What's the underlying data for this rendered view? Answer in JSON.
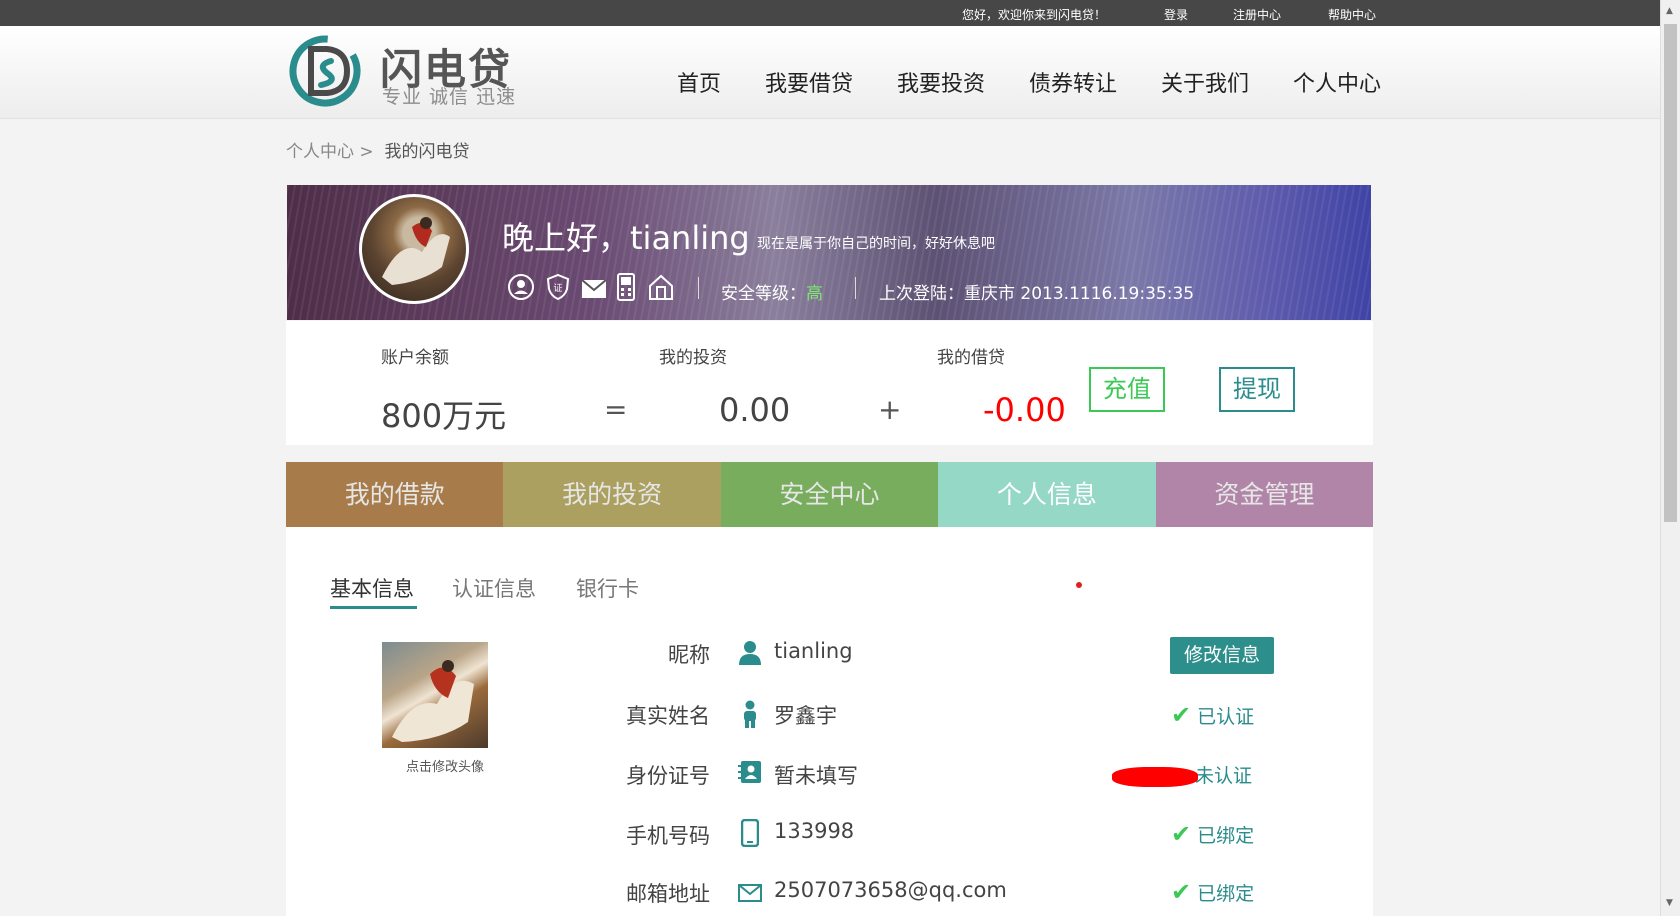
{
  "topbar": {
    "welcome": "您好，欢迎你来到闪电贷！",
    "login": "登录",
    "register": "注册中心",
    "help": "帮助中心"
  },
  "logo": {
    "title": "闪电贷",
    "slogan": "专业 诚信 迅速",
    "color": "#2a8c8c"
  },
  "nav": [
    "首页",
    "我要借贷",
    "我要投资",
    "债券转让",
    "关于我们",
    "个人中心"
  ],
  "breadcrumb": {
    "parent": "个人中心 >",
    "current": "我的闪电贷"
  },
  "banner": {
    "greeting": "晚上好，tianling",
    "subtitle": "现在是属于你自己的时间，好好休息吧",
    "security_label": "安全等级：",
    "security_level": "高",
    "last_login": "上次登陆：重庆市 2013.1116.19:35:35",
    "icons": [
      "user-icon",
      "shield-icon",
      "mail-icon",
      "phone-icon",
      "home-icon"
    ]
  },
  "summary": {
    "balance_label": "账户余额",
    "balance": "800万元",
    "equals": "=",
    "invest_label": "我的投资",
    "invest": "0.00",
    "plus": "+",
    "loan_label": "我的借贷",
    "loan": "-0.00",
    "recharge": "充值",
    "withdraw": "提现",
    "colors": {
      "loan": "#ff0000",
      "recharge": "#3ac955",
      "withdraw": "#2a8c8c"
    }
  },
  "tabs": [
    {
      "label": "我的借款",
      "color": "#a87c4a"
    },
    {
      "label": "我的投资",
      "color": "#aba060"
    },
    {
      "label": "安全中心",
      "color": "#77ad5c"
    },
    {
      "label": "个人信息",
      "color": "#95d8c6"
    },
    {
      "label": "资金管理",
      "color": "#b185a8"
    }
  ],
  "subtabs": [
    "基本信息",
    "认证信息",
    "银行卡"
  ],
  "avatar_caption": "点击修改头像",
  "edit_button": "修改信息",
  "info_rows": [
    {
      "label": "昵称",
      "icon": "person-icon",
      "value": "tianling",
      "status": ""
    },
    {
      "label": "真实姓名",
      "icon": "id-person-icon",
      "value": "罗鑫宇",
      "status": "已认证"
    },
    {
      "label": "身份证号",
      "icon": "id-card-icon",
      "value": "暂未填写",
      "status": "未认证"
    },
    {
      "label": "手机号码",
      "icon": "mobile-icon",
      "value": "133998",
      "status": "已绑定"
    },
    {
      "label": "邮箱地址",
      "icon": "mail-icon",
      "value": "2507073658@qq.com",
      "status": "已绑定"
    }
  ]
}
